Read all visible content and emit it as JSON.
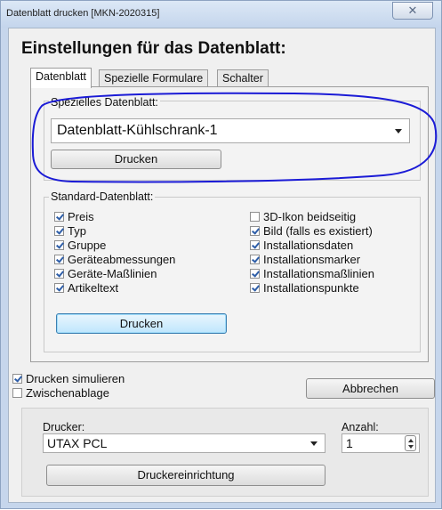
{
  "window": {
    "title": "Datenblatt drucken [MKN-2020315]",
    "close_label": "✕"
  },
  "heading": "Einstellungen für das Datenblatt:",
  "tabs": [
    {
      "label": "Datenblatt",
      "active": true
    },
    {
      "label": "Spezielle Formulare",
      "active": false
    },
    {
      "label": "Schalter",
      "active": false
    }
  ],
  "special": {
    "label": "Spezielles Datenblatt:",
    "selected": "Datenblatt-Kühlschrank-1",
    "print_label": "Drucken"
  },
  "standard": {
    "label": "Standard-Datenblatt:",
    "left": [
      {
        "label": "Preis",
        "checked": true
      },
      {
        "label": "Typ",
        "checked": true
      },
      {
        "label": "Gruppe",
        "checked": true
      },
      {
        "label": "Geräteabmessungen",
        "checked": true
      },
      {
        "label": "Geräte-Maßlinien",
        "checked": true
      },
      {
        "label": "Artikeltext",
        "checked": true
      }
    ],
    "right": [
      {
        "label": "3D-Ikon beidseitig",
        "checked": false
      },
      {
        "label": "Bild (falls es existiert)",
        "checked": true
      },
      {
        "label": "Installationsdaten",
        "checked": true
      },
      {
        "label": "Installationsmarker",
        "checked": true
      },
      {
        "label": "Installationsmaßlinien",
        "checked": true
      },
      {
        "label": "Installationspunkte",
        "checked": true
      }
    ],
    "print_label": "Drucken"
  },
  "options": {
    "simulate_label": "Drucken simulieren",
    "simulate_checked": true,
    "clipboard_label": "Zwischenablage",
    "clipboard_checked": false,
    "cancel_label": "Abbrechen"
  },
  "printer": {
    "label": "Drucker:",
    "selected": "UTAX PCL",
    "count_label": "Anzahl:",
    "count_value": "1",
    "setup_label": "Druckereinrichtung"
  },
  "colors": {
    "annotation": "#1b1bd6",
    "focus_button": "#3c7fb1"
  }
}
